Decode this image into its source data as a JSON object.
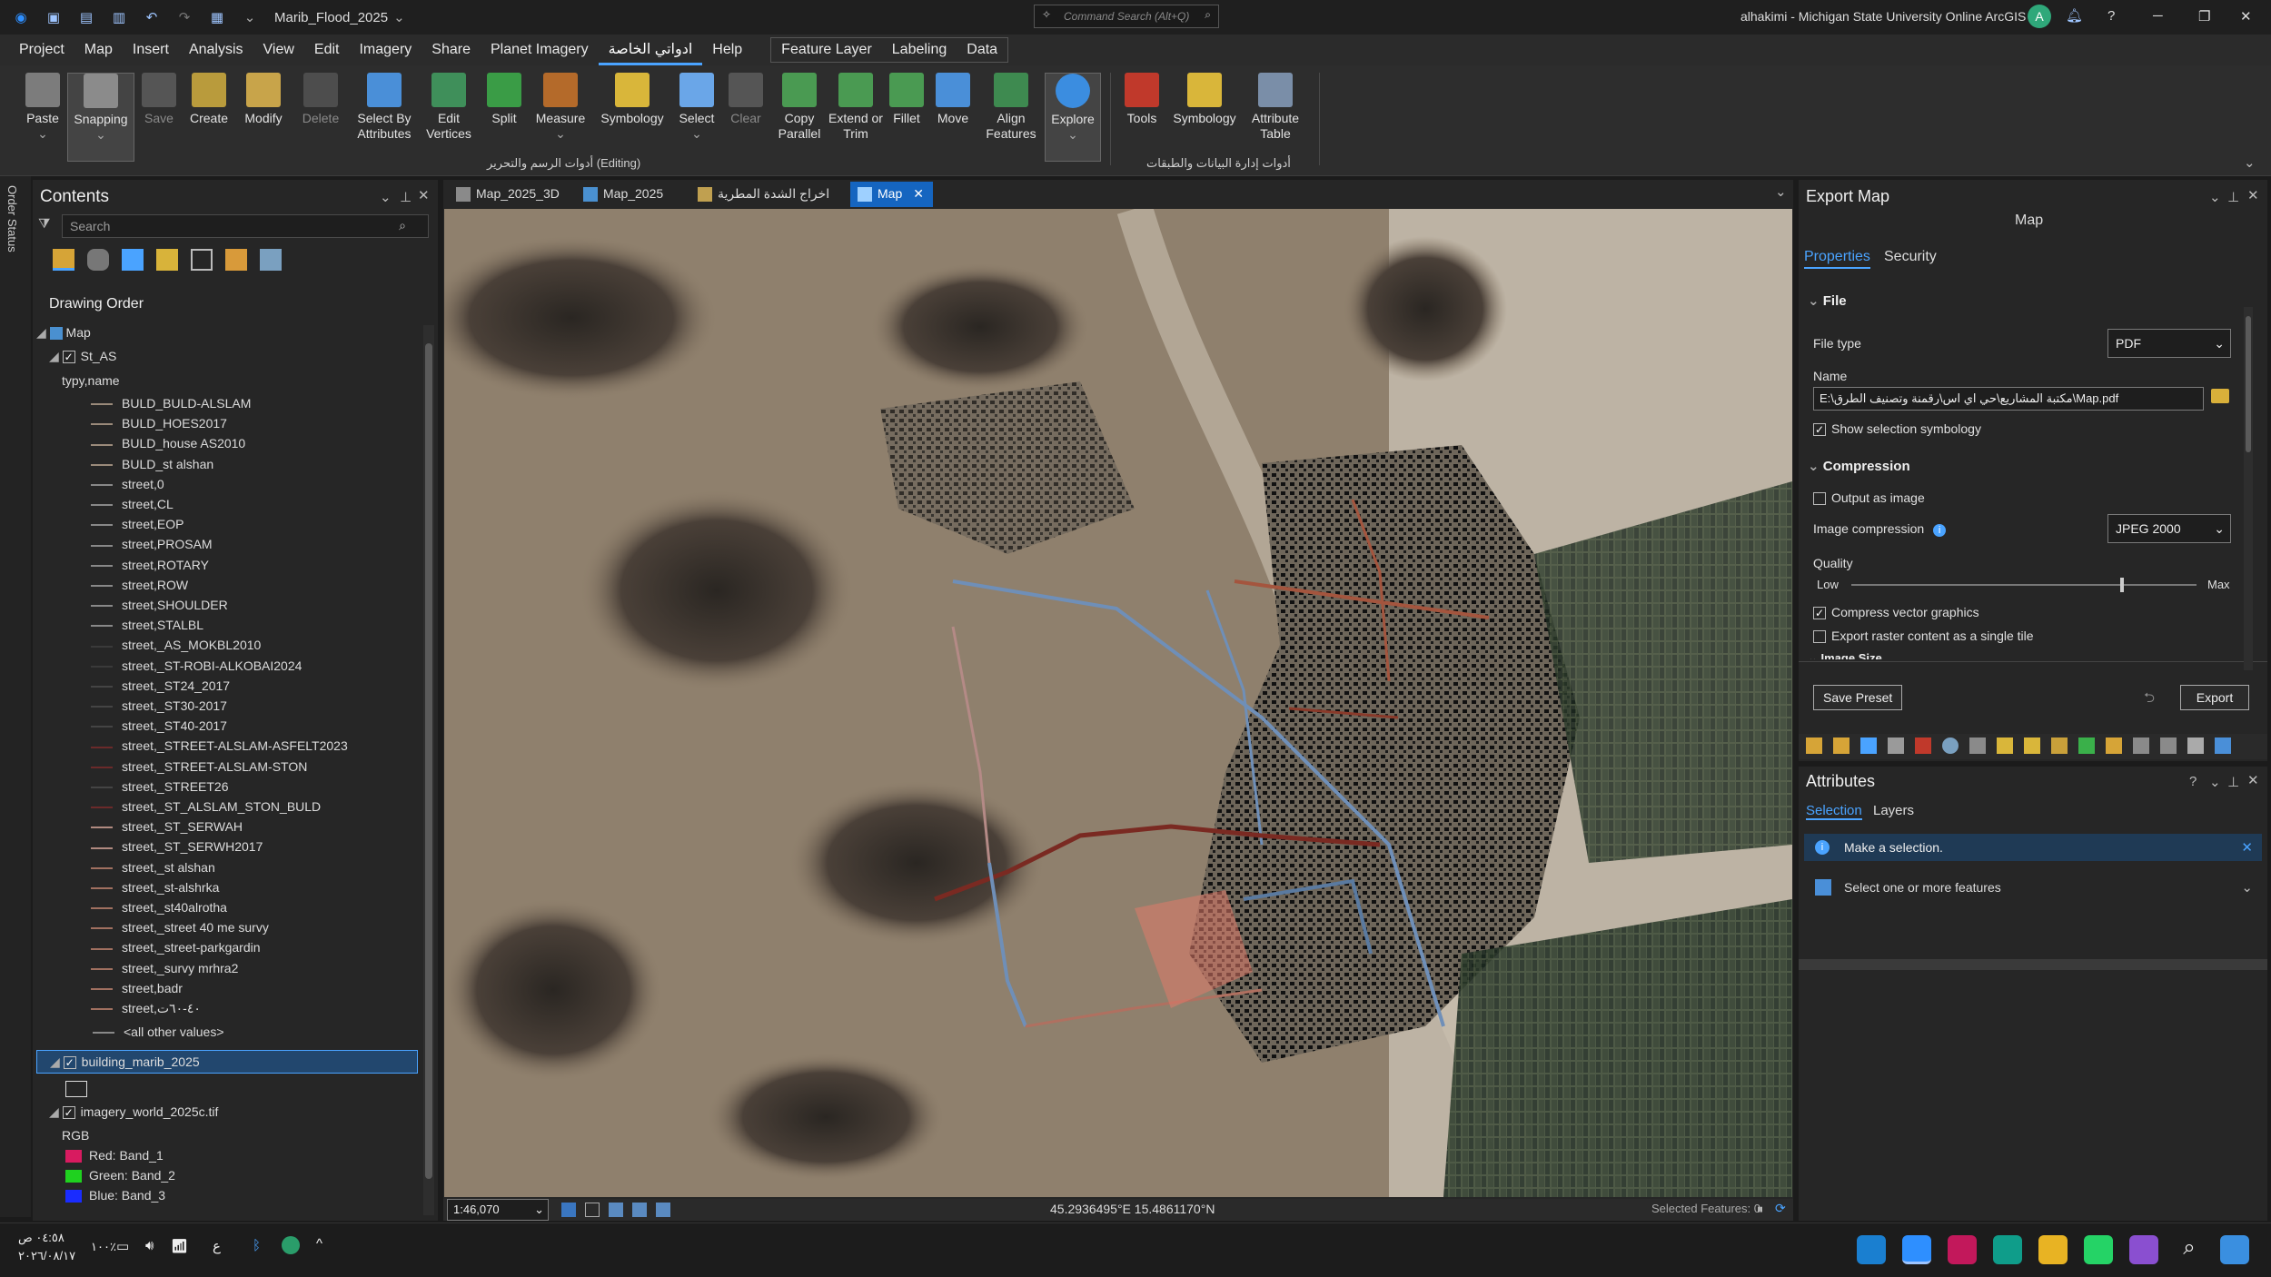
{
  "title_bar": {
    "project": "Marib_Flood_2025",
    "search_placeholder": "Command Search (Alt+Q)",
    "account": "alhakimi - Michigan State University Online ArcGIS",
    "avatar_letter": "A",
    "help": "?",
    "minimize": "─",
    "restore": "❐",
    "close": "✕"
  },
  "menu": [
    "Project",
    "Map",
    "Insert",
    "Analysis",
    "View",
    "Edit",
    "Imagery",
    "Share",
    "Planet Imagery",
    "ادواتي الخاصة",
    "Help"
  ],
  "context_tabs": [
    "Feature Layer",
    "Labeling",
    "Data"
  ],
  "ribbon": {
    "buttons": [
      "Paste",
      "Snapping",
      "Save",
      "Create",
      "Modify",
      "Delete",
      "Select By Attributes",
      "Edit Vertices",
      "Split",
      "Measure",
      "Symbology",
      "Select",
      "Clear",
      "Copy Parallel",
      "Extend or Trim",
      "Fillet",
      "Move",
      "Align Features",
      "Explore",
      "Tools",
      "Symbology",
      "Attribute Table"
    ],
    "group1": "أدوات الرسم والتحرير (Editing)",
    "group2": "أدوات إدارة البيانات والطبقات"
  },
  "left_strip": "Order Status",
  "contents": {
    "title": "Contents",
    "search_placeholder": "Search",
    "drawing_order": "Drawing Order",
    "map": "Map",
    "layer1": "St_AS",
    "field": "typy,name",
    "legend": [
      "BULD_BULD-ALSLAM",
      "BULD_HOES2017",
      "BULD_house AS2010",
      "BULD_st alshan",
      "street,0",
      "street,CL",
      "street,EOP",
      "street,PROSAM",
      "street,ROTARY",
      "street,ROW",
      "street,SHOULDER",
      "street,STALBL",
      "street,_AS_MOKBL2010",
      "street,_ST-ROBI-ALKOBAI2024",
      "street,_ST24_2017",
      "street,_ST30-2017",
      "street,_ST40-2017",
      "street,_STREET-ALSLAM-ASFELT2023",
      "street,_STREET-ALSLAM-STON",
      "street,_STREET26",
      "street,_ST_ALSLAM_STON_BULD",
      "street,_ST_SERWAH",
      "street,_ST_SERWH2017",
      "street,_st alshan",
      "street,_st-alshrka",
      "street,_st40alrotha",
      "street,_street 40 me survy",
      "street,_street-parkgardin",
      "street,_survy mrhra2",
      "street,badr",
      "street,٤٠-٦٠ت"
    ],
    "legend_colors": [
      "#9a8a7a",
      "#9a8a7a",
      "#9a8a7a",
      "#9a8a7a",
      "#888888",
      "#888888",
      "#888888",
      "#888888",
      "#888888",
      "#888888",
      "#888888",
      "#888888",
      "#3a3a3a",
      "#3a3a3a",
      "#444444",
      "#444444",
      "#444444",
      "#6b2a2a",
      "#6b2a2a",
      "#444444",
      "#6b2a2a",
      "#b08a80",
      "#b08a80",
      "#a07060",
      "#a07060",
      "#a07060",
      "#a07060",
      "#a07060",
      "#a07060",
      "#a07060",
      "#a07060"
    ],
    "other_values": "<all other values>",
    "layer2": "building_marib_2025",
    "layer3": "imagery_world_2025c.tif",
    "rgb": "RGB",
    "bands": [
      "Red:  Band_1",
      "Green:  Band_2",
      "Blue:  Band_3"
    ]
  },
  "map_tabs": [
    "Map_2025_3D",
    "Map_2025",
    "اخراج الشدة المطرية",
    "Map"
  ],
  "map_status": {
    "scale": "1:46,070",
    "coords": "45.2936495°E 15.4861170°N",
    "selected": "Selected Features: 0"
  },
  "export": {
    "title": "Export Map",
    "subtitle": "Map",
    "tab_properties": "Properties",
    "tab_security": "Security",
    "file_section": "File",
    "file_type_label": "File type",
    "file_type": "PDF",
    "name_label": "Name",
    "name_value": "E:\\مكتبة المشاريع\\حي اي اس\\رقمنة وتصنيف الطرق\\Map.pdf",
    "show_selection": "Show selection symbology",
    "compression_section": "Compression",
    "output_as_image": "Output as image",
    "image_compression_label": "Image compression",
    "image_compression": "JPEG 2000",
    "quality_label": "Quality",
    "low": "Low",
    "max": "Max",
    "quality": 0.78,
    "compress_vector": "Compress vector graphics",
    "export_raster": "Export raster content as a single tile",
    "image_size": "Image Size",
    "save_preset": "Save Preset",
    "export_button": "Export"
  },
  "attributes": {
    "title": "Attributes",
    "tab_selection": "Selection",
    "tab_layers": "Layers",
    "info": "Make a selection.",
    "select_hint": "Select one or more features"
  },
  "taskbar": {
    "time": "٠٤:٥٨ ص",
    "date": "٢٠٢٦/٠٨/١٧",
    "battery": "١٠٠٪",
    "lang": "ع"
  },
  "colors": {
    "accent": "#4aa3ff",
    "selected": "#1565c0",
    "info_bar": "#1f3a55"
  }
}
